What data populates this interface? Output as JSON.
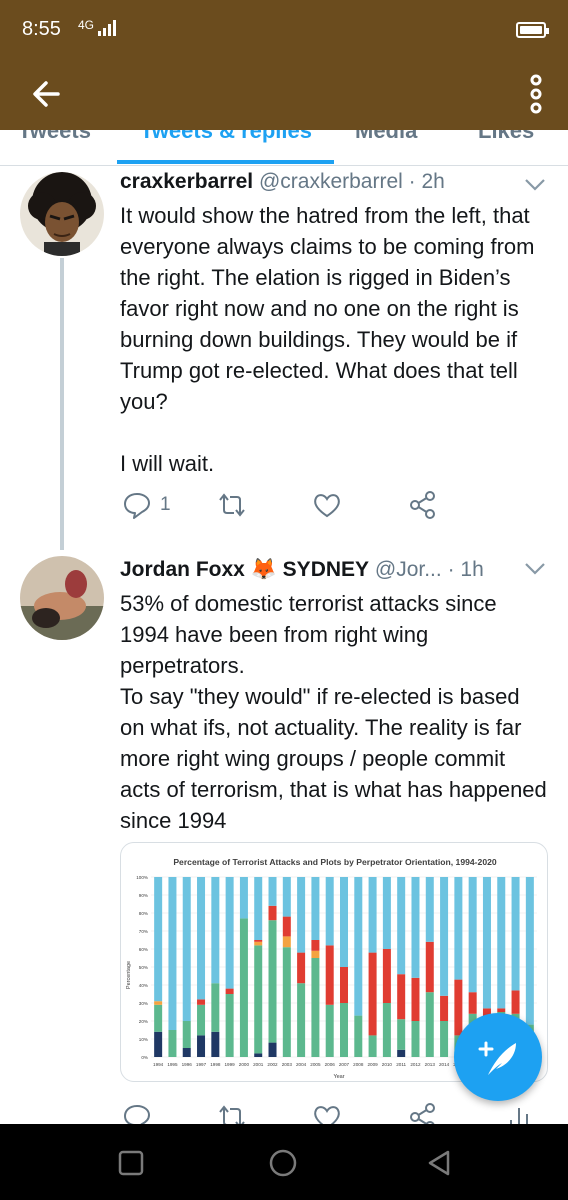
{
  "status_bar": {
    "time": "8:55",
    "network": "4G",
    "colors": {
      "bar": "#6b4c1e"
    }
  },
  "tabs": [
    {
      "label": "Tweets"
    },
    {
      "label": "Tweets & replies"
    },
    {
      "label": "Media"
    },
    {
      "label": "Likes"
    }
  ],
  "tweets": [
    {
      "name": "craxkerbarrel",
      "handle": "@craxkerbarrel",
      "time": "· 2h",
      "text": "It would show the hatred from the left, that everyone always claims to be coming from the right. The elation is rigged in Biden’s favor right now and no one on the right is burning down buildings. They would be if Trump got re-elected. What does that tell you?\n\nI will wait.",
      "reply_count": "1"
    },
    {
      "name": "Jordan Foxx 🦊 SYDNEY",
      "handle": "@Jor...",
      "time": "· 1h",
      "text": "53% of domestic terrorist attacks since 1994 have been from right wing perpetrators.\nTo say \"they would\" if re-elected is based on what ifs, not actuality. The reality is far more right wing groups / people commit acts of terrorism, that is what has happened since 1994"
    }
  ],
  "chart_data": {
    "type": "bar",
    "title": "Percentage of Terrorist Attacks and Plots by Perpetrator Orientation, 1994-2020",
    "xlabel": "Year",
    "ylabel": "Percentage",
    "ylim": [
      0,
      100
    ],
    "yticks": [
      "0%",
      "10%",
      "20%",
      "30%",
      "40%",
      "50%",
      "60%",
      "70%",
      "80%",
      "90%",
      "100%"
    ],
    "categories": [
      "1994",
      "1995",
      "1996",
      "1997",
      "1998",
      "1999",
      "2000",
      "2001",
      "2002",
      "2003",
      "2004",
      "2005",
      "2006",
      "2007",
      "2008",
      "2009",
      "2010",
      "2011",
      "2012",
      "2013",
      "2014",
      "2015",
      "2016",
      "2017",
      "2018",
      "2019",
      "2020"
    ],
    "series": [
      {
        "values": [
          14,
          0,
          5,
          12,
          14,
          0,
          0,
          2,
          8,
          0,
          0,
          0,
          0,
          0,
          0,
          0,
          0,
          4,
          0,
          0,
          0,
          0,
          0,
          0,
          0,
          0,
          0
        ],
        "color": "#1f3864"
      },
      {
        "values": [
          15,
          15,
          15,
          17,
          27,
          35,
          77,
          60,
          68,
          61,
          41,
          55,
          29,
          30,
          23,
          12,
          30,
          17,
          20,
          36,
          20,
          12,
          24,
          20,
          25,
          24,
          18
        ],
        "color": "#5cb88e"
      },
      {
        "values": [
          2,
          0,
          0,
          0,
          0,
          0,
          0,
          2,
          0,
          6,
          0,
          4,
          0,
          0,
          0,
          0,
          0,
          0,
          0,
          0,
          0,
          0,
          0,
          0,
          0,
          0,
          0
        ],
        "color": "#f4a340"
      },
      {
        "values": [
          0,
          0,
          0,
          3,
          0,
          3,
          0,
          1,
          8,
          11,
          17,
          6,
          33,
          20,
          0,
          46,
          30,
          25,
          24,
          28,
          14,
          31,
          12,
          7,
          2,
          13,
          0
        ],
        "color": "#e03c31"
      },
      {
        "values": [
          69,
          85,
          80,
          68,
          59,
          62,
          23,
          35,
          16,
          22,
          42,
          35,
          38,
          50,
          77,
          42,
          40,
          54,
          56,
          36,
          66,
          57,
          64,
          73,
          73,
          63,
          82
        ],
        "color": "#6cc3e0"
      }
    ]
  }
}
